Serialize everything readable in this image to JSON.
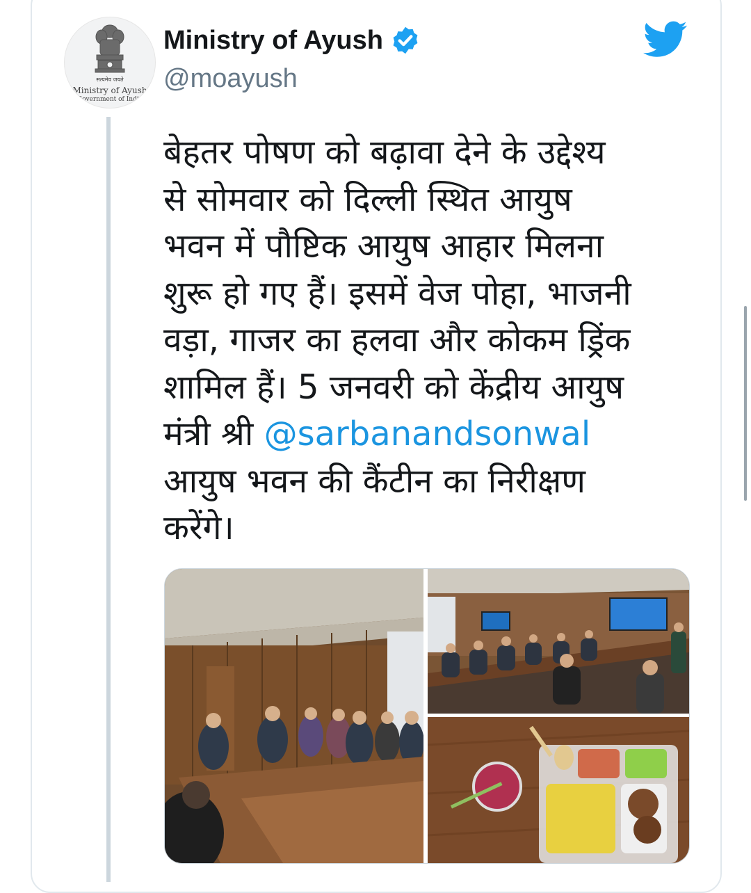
{
  "account": {
    "display_name": "Ministry of Ayush",
    "handle": "@moayush",
    "verified": true,
    "avatar_emblem": {
      "motto": "सत्यमेव जयते",
      "name": "Ministry of Ayush",
      "gov": "Government of India"
    }
  },
  "tweet": {
    "lines": [
      "बेहतर पोषण को बढ़ावा देने के उद्देश्य",
      "से सोमवार को दिल्ली स्थित आयुष",
      "भवन में पौष्टिक आयुष आहार मिलना",
      "शुरू हो गए हैं। इसमें वेज पोहा, भाजनी",
      "वड़ा, गाजर का हलवा और कोकम ड्रिंक",
      "शामिल हैं। 5 जनवरी को केंद्रीय आयुष"
    ],
    "line7_prefix": "मंत्री श्री ",
    "mention": "@sarbanandsonwal",
    "lines_after": [
      "आयुष भवन की कैंटीन का निरीक्षण",
      "करेंगे।"
    ]
  },
  "icons": {
    "bird": "twitter-bird-icon",
    "verified": "verified-badge-icon"
  },
  "colors": {
    "twitter_blue": "#1da1f2",
    "mention_blue": "#1b95e0",
    "text": "#14171a",
    "secondary": "#657786",
    "border": "#e1e8ed",
    "thread_line": "#ccd6dd"
  }
}
